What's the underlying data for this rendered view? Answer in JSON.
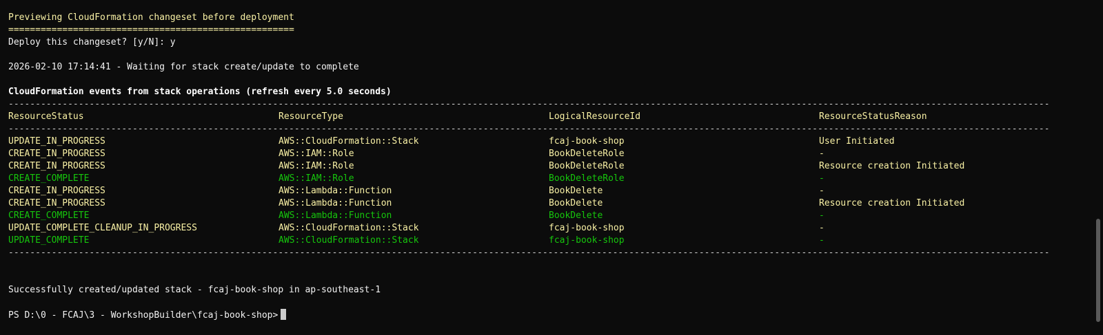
{
  "terminal": {
    "preview_title": "Previewing CloudFormation changeset before deployment",
    "preview_rule": "=====================================================",
    "deploy_prompt": "Deploy this changeset? [y/N]: y",
    "waiting_message": "2026-02-10 17:14:41 - Waiting for stack create/update to complete",
    "events_title": "CloudFormation events from stack operations (refresh every 5.0 seconds)",
    "dash_rule": "-------------------------------------------------------------------------------------------------------------------------------------------------------------------------------------------------",
    "table": {
      "headers": [
        "ResourceStatus",
        "ResourceType",
        "LogicalResourceId",
        "ResourceStatusReason"
      ],
      "rows": [
        {
          "status": "UPDATE_IN_PROGRESS",
          "type": "AWS::CloudFormation::Stack",
          "id": "fcaj-book-shop",
          "reason": "User Initiated",
          "color": "yellow"
        },
        {
          "status": "CREATE_IN_PROGRESS",
          "type": "AWS::IAM::Role",
          "id": "BookDeleteRole",
          "reason": "-",
          "color": "yellow"
        },
        {
          "status": "CREATE_IN_PROGRESS",
          "type": "AWS::IAM::Role",
          "id": "BookDeleteRole",
          "reason": "Resource creation Initiated",
          "color": "yellow"
        },
        {
          "status": "CREATE_COMPLETE",
          "type": "AWS::IAM::Role",
          "id": "BookDeleteRole",
          "reason": "-",
          "color": "green"
        },
        {
          "status": "CREATE_IN_PROGRESS",
          "type": "AWS::Lambda::Function",
          "id": "BookDelete",
          "reason": "-",
          "color": "yellow"
        },
        {
          "status": "CREATE_IN_PROGRESS",
          "type": "AWS::Lambda::Function",
          "id": "BookDelete",
          "reason": "Resource creation Initiated",
          "color": "yellow"
        },
        {
          "status": "CREATE_COMPLETE",
          "type": "AWS::Lambda::Function",
          "id": "BookDelete",
          "reason": "-",
          "color": "green"
        },
        {
          "status": "UPDATE_COMPLETE_CLEANUP_IN_PROGRESS",
          "type": "AWS::CloudFormation::Stack",
          "id": "fcaj-book-shop",
          "reason": "-",
          "color": "yellow"
        },
        {
          "status": "UPDATE_COMPLETE",
          "type": "AWS::CloudFormation::Stack",
          "id": "fcaj-book-shop",
          "reason": "-",
          "color": "green"
        }
      ]
    },
    "success_message": "Successfully created/updated stack - fcaj-book-shop in ap-southeast-1",
    "prompt": "PS D:\\0 - FCAJ\\3 - WorkshopBuilder\\fcaj-book-shop>"
  },
  "colors": {
    "background": "#0c0c0c",
    "yellow": "#f9f1a5",
    "green": "#16c60c",
    "text": "#cccccc"
  }
}
